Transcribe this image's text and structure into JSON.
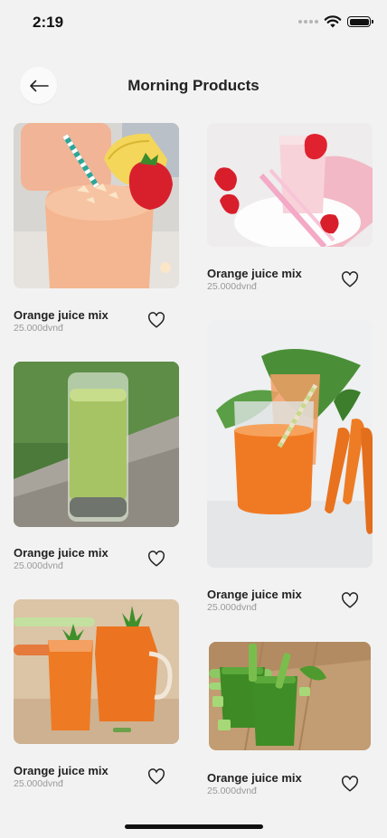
{
  "status": {
    "time": "2:19"
  },
  "header": {
    "title": "Morning Products"
  },
  "products": [
    {
      "name": "Orange juice mix",
      "price": "25.000dvnđ",
      "image": "peach-smoothie"
    },
    {
      "name": "Orange juice mix",
      "price": "25.000dvnđ",
      "image": "strawberry-smoothie"
    },
    {
      "name": "Orange juice mix",
      "price": "25.000dvnđ",
      "image": "green-juice-glass"
    },
    {
      "name": "Orange juice mix",
      "price": "25.000dvnđ",
      "image": "carrot-juice-glasses"
    },
    {
      "name": "Orange juice mix",
      "price": "25.000dvnđ",
      "image": "carrot-juice-pitcher"
    },
    {
      "name": "Orange juice mix",
      "price": "25.000dvnđ",
      "image": "celery-juice"
    }
  ],
  "icons": {
    "back": "arrow-left-icon",
    "favorite": "heart-outline-icon"
  }
}
